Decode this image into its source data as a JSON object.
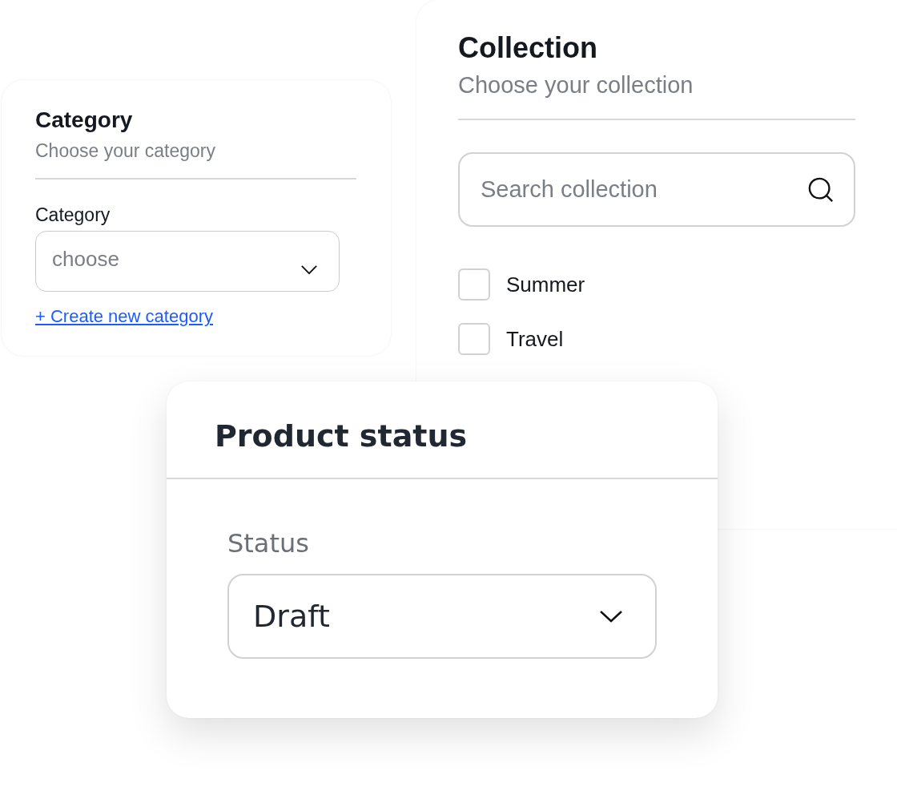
{
  "category_card": {
    "title": "Category",
    "subtitle": "Choose your category",
    "field_label": "Category",
    "select": {
      "placeholder": "choose"
    },
    "link": "+ Create new category"
  },
  "collection_card": {
    "title": "Collection",
    "subtitle": "Choose your collection",
    "search": {
      "placeholder": "Search collection"
    },
    "items": [
      {
        "label": "Summer",
        "checked": false
      },
      {
        "label": "Travel",
        "checked": false
      }
    ]
  },
  "status_card": {
    "title": "Product status",
    "field_label": "Status",
    "select": {
      "value": "Draft"
    }
  }
}
